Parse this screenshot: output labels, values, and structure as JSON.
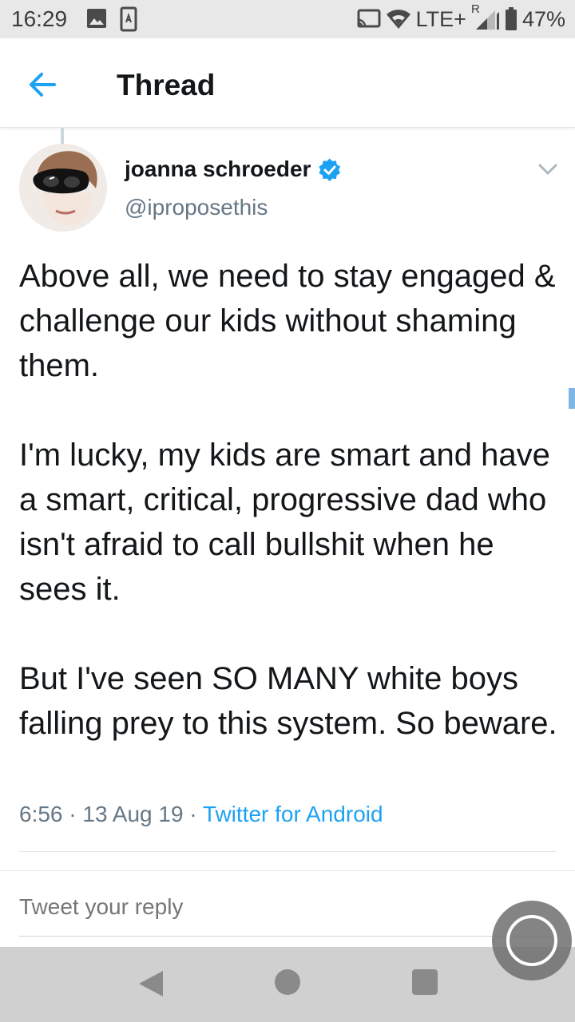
{
  "status_bar": {
    "time": "16:29",
    "network": "LTE+",
    "roaming": "R",
    "battery": "47%",
    "icons": [
      "image-icon",
      "sim-card-icon",
      "cast-icon",
      "wifi-icon",
      "signal-icon",
      "battery-icon"
    ]
  },
  "app_bar": {
    "title": "Thread",
    "back_icon": "arrow-left-icon"
  },
  "tweet": {
    "author_name": "joanna schroeder",
    "verified": true,
    "handle": "@iproposethis",
    "text": "Above all, we need to stay engaged & challenge our kids without shaming them.\n\nI'm lucky, my kids are smart and have a smart, critical, progressive dad who isn't afraid to call bullshit when he sees it.\n\nBut I've seen SO MANY white boys falling prey to this system. So beware.",
    "time": "6:56",
    "date": "13 Aug 19",
    "source": "Twitter for Android"
  },
  "reply": {
    "placeholder": "Tweet your reply"
  },
  "colors": {
    "accent": "#1da1f2",
    "secondary_text": "#657786",
    "primary_text": "#14171a",
    "status_bar_bg": "#e8e8e8",
    "nav_bar_bg": "#d0d0d0"
  }
}
